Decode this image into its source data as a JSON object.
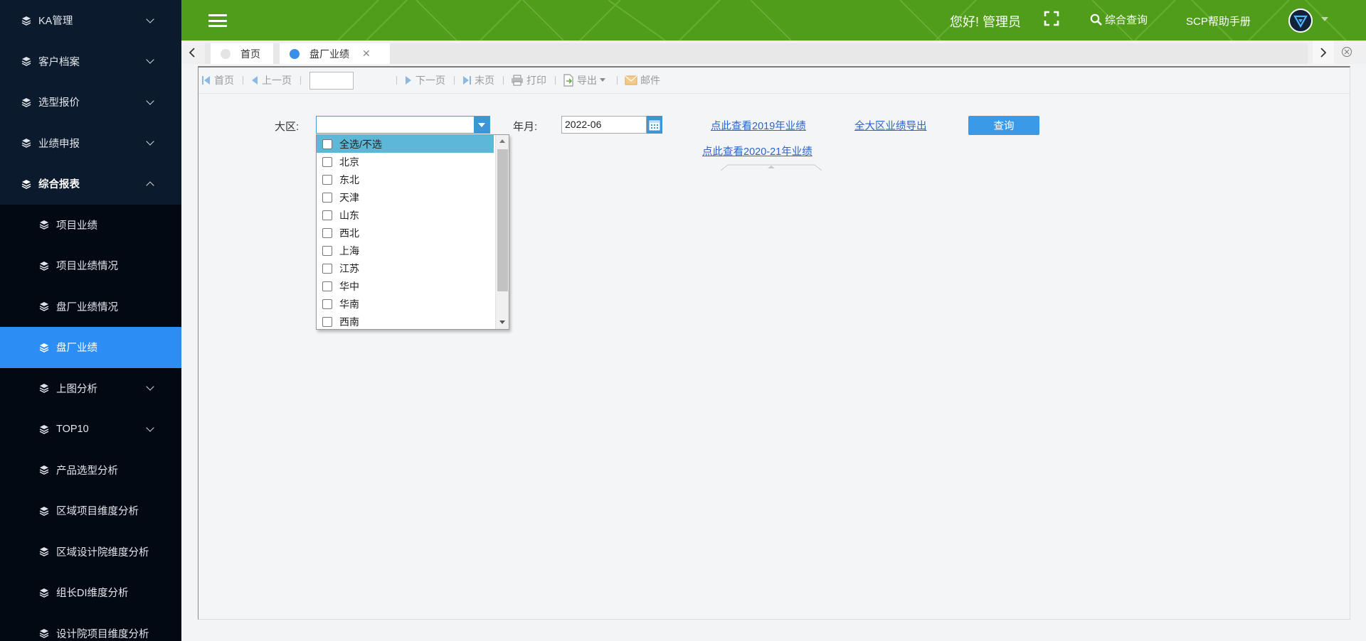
{
  "sidebar": {
    "items": [
      {
        "label": "KA管理",
        "has_chevron": true
      },
      {
        "label": "客户档案",
        "has_chevron": true
      },
      {
        "label": "选型报价",
        "has_chevron": true
      },
      {
        "label": "业绩申报",
        "has_chevron": true
      },
      {
        "label": "综合报表",
        "has_chevron": true,
        "expanded": true
      }
    ],
    "sub_items": [
      {
        "label": "项目业绩"
      },
      {
        "label": "项目业绩情况"
      },
      {
        "label": "盘厂业绩情况"
      },
      {
        "label": "盘厂业绩",
        "active": true
      },
      {
        "label": "上图分析",
        "has_chevron": true
      },
      {
        "label": "TOP10",
        "has_chevron": true
      },
      {
        "label": "产品选型分析"
      },
      {
        "label": "区域项目维度分析"
      },
      {
        "label": "区域设计院维度分析"
      },
      {
        "label": "组长DI维度分析"
      },
      {
        "label": "设计院项目维度分析"
      }
    ]
  },
  "header": {
    "greeting": "您好! 管理员",
    "search_label": "综合查询",
    "help_label": "SCP帮助手册",
    "icons": [
      "menu-icon",
      "fullscreen-icon",
      "search-icon",
      "user-avatar"
    ]
  },
  "tabs": [
    {
      "label": "首页",
      "active": false
    },
    {
      "label": "盘厂业绩",
      "active": true
    }
  ],
  "toolbar": {
    "first": "首页",
    "prev": "上一页",
    "page_value": "",
    "next": "下一页",
    "last": "末页",
    "print": "打印",
    "export": "导出",
    "mail": "邮件"
  },
  "form": {
    "region_label": "大区:",
    "region_value": "",
    "month_label": "年月:",
    "month_value": "2022-06",
    "link_2019": "点此查看2019年业绩",
    "link_2020_21": "点此查看2020-21年业绩",
    "export_all": "全大区业绩导出",
    "query_button": "查询"
  },
  "region_options": [
    {
      "label": "全选/不选",
      "highlighted": true
    },
    {
      "label": "北京"
    },
    {
      "label": "东北"
    },
    {
      "label": "天津"
    },
    {
      "label": "山东"
    },
    {
      "label": "西北"
    },
    {
      "label": "上海"
    },
    {
      "label": "江苏"
    },
    {
      "label": "华中"
    },
    {
      "label": "华南"
    },
    {
      "label": "西南"
    }
  ],
  "colors": {
    "header_green": "#4f9d1a",
    "sidebar_bg": "#081423",
    "active_blue": "#2c8df4",
    "query_blue": "#3b9ae8",
    "link_blue": "#2e62c8",
    "highlight": "#5cb8d6"
  }
}
